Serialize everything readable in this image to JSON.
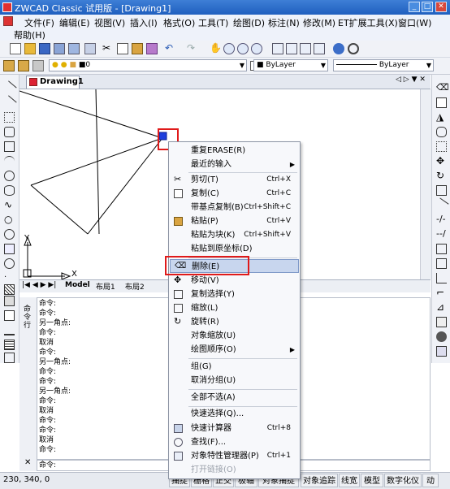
{
  "window": {
    "title": "ZWCAD Classic 试用版 - [Drawing1]"
  },
  "menubar": {
    "items": [
      "文件(F)",
      "编辑(E)",
      "视图(V)",
      "插入(I)",
      "格式(O)",
      "工具(T)",
      "绘图(D)",
      "标注(N)",
      "修改(M)",
      "ET扩展工具(X)",
      "窗口(W)",
      "帮助(H)"
    ]
  },
  "toolbar2": {
    "color_value": "0",
    "linetype": "ByLayer",
    "lineweight": "ByLayer"
  },
  "doc_tab": {
    "label": "Drawing1"
  },
  "layout_tabs": [
    "Model",
    "布局1",
    "布局2"
  ],
  "command_history": {
    "side_label": "命令行",
    "lines": [
      "命令:",
      "命令:",
      "另一角点:",
      "命令:",
      "取消",
      "命令:",
      "另一角点:",
      "命令:",
      "命令:",
      "另一角点:",
      "命令:",
      "取消",
      "命令:",
      "命令:",
      "取消",
      "命令:"
    ]
  },
  "command_prompt": "命令:",
  "status": {
    "coords": "230, 340, 0",
    "buttons": [
      "捕捉",
      "栅格",
      "正交",
      "极轴",
      "对象捕捉",
      "对象追踪",
      "线宽",
      "模型",
      "数字化仪",
      "动"
    ]
  },
  "axis": {
    "x_label": "X",
    "y_label": "Y"
  },
  "context_menu": {
    "items": [
      {
        "label": "重复ERASE(R)",
        "shortcut": "",
        "submenu": false,
        "icon": ""
      },
      {
        "label": "最近的输入",
        "shortcut": "",
        "submenu": true,
        "icon": ""
      },
      {
        "label": "剪切(T)",
        "shortcut": "Ctrl+X",
        "submenu": false,
        "icon": "scissors-icon"
      },
      {
        "label": "复制(C)",
        "shortcut": "Ctrl+C",
        "submenu": false,
        "icon": "copy-icon"
      },
      {
        "label": "带基点复制(B)",
        "shortcut": "Ctrl+Shift+C",
        "submenu": false,
        "icon": ""
      },
      {
        "label": "粘贴(P)",
        "shortcut": "Ctrl+V",
        "submenu": false,
        "icon": "paste-icon"
      },
      {
        "label": "粘贴为块(K)",
        "shortcut": "Ctrl+Shift+V",
        "submenu": false,
        "icon": ""
      },
      {
        "label": "粘贴到原坐标(D)",
        "shortcut": "",
        "submenu": false,
        "icon": ""
      },
      {
        "label": "删除(E)",
        "shortcut": "",
        "submenu": false,
        "icon": "eraser-icon"
      },
      {
        "label": "移动(V)",
        "shortcut": "",
        "submenu": false,
        "icon": "move-icon"
      },
      {
        "label": "复制选择(Y)",
        "shortcut": "",
        "submenu": false,
        "icon": "copy-selection-icon"
      },
      {
        "label": "缩放(L)",
        "shortcut": "",
        "submenu": false,
        "icon": "scale-icon"
      },
      {
        "label": "旋转(R)",
        "shortcut": "",
        "submenu": false,
        "icon": "rotate-icon"
      },
      {
        "label": "对象缩放(U)",
        "shortcut": "",
        "submenu": false,
        "icon": ""
      },
      {
        "label": "绘图顺序(O)",
        "shortcut": "",
        "submenu": true,
        "icon": ""
      },
      {
        "label": "组(G)",
        "shortcut": "",
        "submenu": false,
        "icon": ""
      },
      {
        "label": "取消分组(U)",
        "shortcut": "",
        "submenu": false,
        "icon": ""
      },
      {
        "label": "全部不选(A)",
        "shortcut": "",
        "submenu": false,
        "icon": ""
      },
      {
        "label": "快速选择(Q)...",
        "shortcut": "",
        "submenu": false,
        "icon": ""
      },
      {
        "label": "快速计算器",
        "shortcut": "Ctrl+8",
        "submenu": false,
        "icon": "calculator-icon"
      },
      {
        "label": "查找(F)...",
        "shortcut": "",
        "submenu": false,
        "icon": "find-icon"
      },
      {
        "label": "对象特性管理器(P)",
        "shortcut": "Ctrl+1",
        "submenu": false,
        "icon": "properties-icon"
      },
      {
        "label": "打开链接(O)",
        "shortcut": "",
        "submenu": false,
        "icon": "",
        "disabled": true
      }
    ],
    "highlighted": "删除(E)"
  },
  "colors": {
    "title_bar": "#2a6cc9",
    "highlight": "#c8d6ee",
    "annotation_red": "#e01a1a",
    "grip_blue": "#1f3fdc"
  }
}
